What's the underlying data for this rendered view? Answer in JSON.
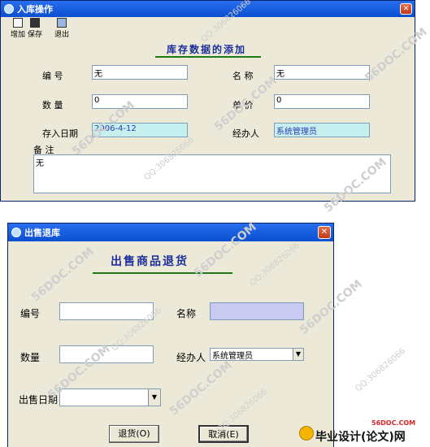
{
  "win1": {
    "title": "入库操作",
    "close": "✕",
    "toolbar": [
      {
        "label": "增加"
      },
      {
        "label": "保存"
      },
      {
        "label": "退出"
      }
    ],
    "heading": "库存数据的添加",
    "labels": {
      "code": "编  号",
      "name": "名  称",
      "qty": "数  量",
      "price": "单  价",
      "date": "存入日期",
      "handler": "经办人",
      "remark": "备  注"
    },
    "values": {
      "code": "无",
      "name": "无",
      "qty": "0",
      "price": "0",
      "date": "2006-4-12",
      "handler": "系统管理员",
      "remark": "无"
    }
  },
  "win2": {
    "title": "出售退库",
    "close": "✕",
    "heading": "出售商品退货",
    "labels": {
      "code": "编号",
      "name": "名称",
      "qty": "数量",
      "handler": "经办人",
      "date": "出售日期"
    },
    "values": {
      "code": "",
      "name": "",
      "qty": "",
      "handler": "系统管理员",
      "date": ""
    },
    "buttons": {
      "return": "退货(O)",
      "cancel": "取消(E)"
    }
  },
  "watermarks": [
    "56DOC.COM",
    "QQ:306826066"
  ],
  "footer": {
    "site": "56DOC.COM",
    "text": "毕业设计(论文)网"
  }
}
